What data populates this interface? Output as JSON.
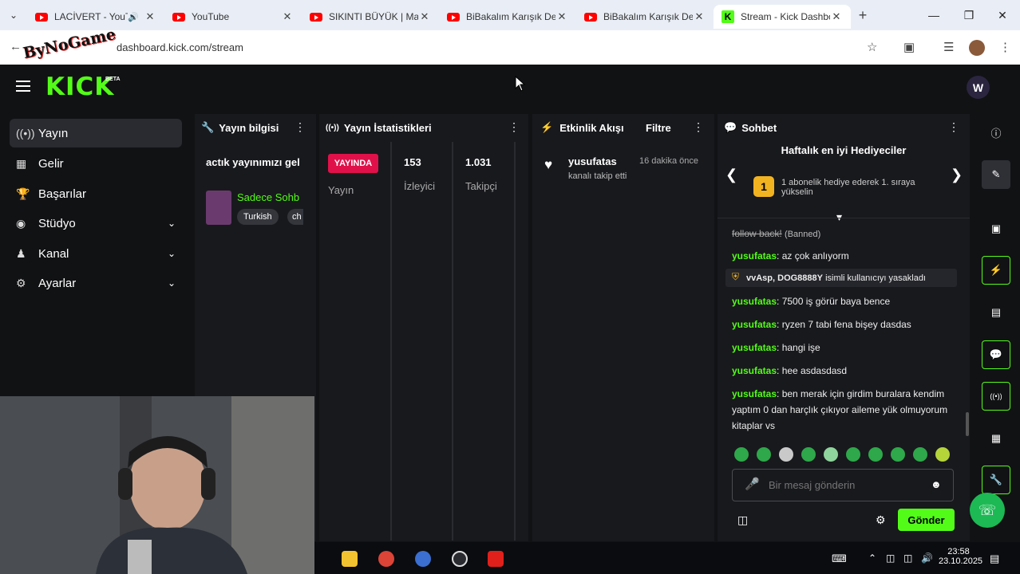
{
  "browser": {
    "tabs": [
      {
        "title": "LACİVERT - YouTu",
        "icon": "youtube-icon"
      },
      {
        "title": "YouTube",
        "icon": "youtube-icon"
      },
      {
        "title": "SIKINTI BÜYÜK | Mad",
        "icon": "youtube-icon"
      },
      {
        "title": "BiBakalım Karışık Der",
        "icon": "youtube-icon"
      },
      {
        "title": "BiBakalım Karışık Der",
        "icon": "youtube-icon"
      },
      {
        "title": "Stream - Kick Dashbo",
        "icon": "kick-icon"
      }
    ],
    "url": "dashboard.kick.com/stream",
    "overlay_logo": "ByNoGame"
  },
  "kick": {
    "logo": "KICK",
    "beta": "BETA",
    "avatar_letter": "W",
    "accent": "#53fc18"
  },
  "sidebar": {
    "items": [
      {
        "label": "Yayın",
        "icon": "broadcast-icon",
        "active": true
      },
      {
        "label": "Gelir",
        "icon": "chart-icon"
      },
      {
        "label": "Başarılar",
        "icon": "trophy-icon"
      },
      {
        "label": "Stüdyo",
        "icon": "studio-icon",
        "expandable": true
      },
      {
        "label": "Kanal",
        "icon": "users-icon",
        "expandable": true
      },
      {
        "label": "Ayarlar",
        "icon": "gear-icon",
        "expandable": true
      }
    ]
  },
  "stream_info": {
    "header": "Yayın bilgisi",
    "title": "actık yayınımızı gel",
    "category": "Sadece Sohb",
    "tags": [
      "Turkish",
      "ch"
    ]
  },
  "stats": {
    "header": "Yayın İstatistikleri",
    "live_badge": "YAYINDA",
    "live_label": "Yayın",
    "viewers": "153",
    "viewers_label": "İzleyici",
    "followers": "1.031",
    "followers_label": "Takipçi"
  },
  "activity": {
    "header": "Etkinlik Akışı",
    "filter": "Filtre",
    "events": [
      {
        "user": "yusufatas",
        "text": "kanalı takip etti",
        "time": "16 dakika önce"
      }
    ]
  },
  "chat": {
    "header": "Sohbet",
    "gifters_title": "Haftalık en iyi Hediyeciler",
    "gifters_rank": "1",
    "gifters_text": "1 abonelik hediye ederek 1. sıraya yükselin",
    "messages": [
      {
        "user": "follow back!",
        "text": "(Banned)",
        "type": "banned"
      },
      {
        "user": "yusufatas",
        "text": ": az çok anlıyorm"
      },
      {
        "user": "vvAsp, DOG8888Y",
        "text": "isimli kullanıcıyı yasakladı",
        "type": "mod"
      },
      {
        "user": "yusufatas",
        "text": ": 7500 iş görür baya bence"
      },
      {
        "user": "yusufatas",
        "text": ": ryzen 7 tabi fena bişey dasdas"
      },
      {
        "user": "yusufatas",
        "text": ": hangi işe"
      },
      {
        "user": "yusufatas",
        "text": ": hee asdasdasd"
      },
      {
        "user": "yusufatas",
        "text": ": ben merak için girdim buralara kendim yaptım 0 dan harçlık çıkıyor aileme yük olmuyorum kitaplar vs"
      }
    ],
    "input_placeholder": "Bir mesaj gönderin",
    "send_label": "Gönder"
  },
  "taskbar": {
    "time": "23:58",
    "date": "23.10.2025"
  }
}
